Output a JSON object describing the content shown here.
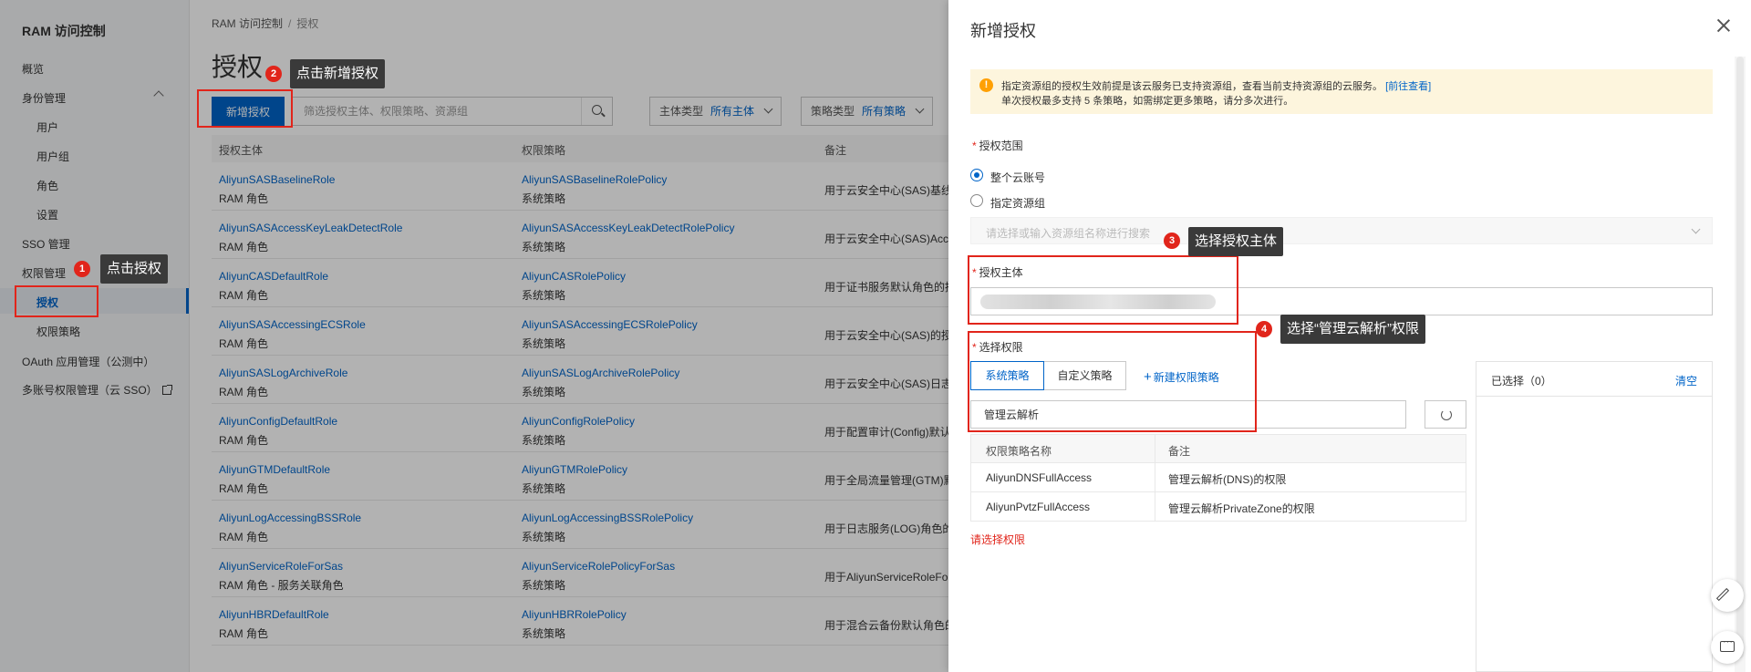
{
  "sidebar": {
    "title": "RAM 访问控制",
    "items": [
      {
        "label": "概览"
      },
      {
        "label": "身份管理"
      },
      {
        "label": "用户"
      },
      {
        "label": "用户组"
      },
      {
        "label": "角色"
      },
      {
        "label": "设置"
      },
      {
        "label": "SSO 管理"
      },
      {
        "label": "权限管理"
      },
      {
        "label": "授权"
      },
      {
        "label": "权限策略"
      },
      {
        "label": "OAuth 应用管理（公测中）"
      },
      {
        "label": "多账号权限管理（云 SSO）"
      }
    ]
  },
  "breadcrumb": {
    "root": "RAM 访问控制",
    "sep": "/",
    "current": "授权"
  },
  "page": {
    "title": "授权",
    "add_button": "新增授权",
    "search_placeholder": "筛选授权主体、权限策略、资源组",
    "filter1_label": "主体类型",
    "filter1_value": "所有主体",
    "filter2_label": "策略类型",
    "filter2_value": "所有策略"
  },
  "table": {
    "headers": [
      "授权主体",
      "权限策略",
      "备注"
    ],
    "rows": [
      {
        "principal": "AliyunSASBaselineRole",
        "ptype": "RAM 角色",
        "policy": "AliyunSASBaselineRolePolicy",
        "pol_type": "系统策略",
        "note": "用于云安全中心(SAS)基线"
      },
      {
        "principal": "AliyunSASAccessKeyLeakDetectRole",
        "ptype": "RAM 角色",
        "policy": "AliyunSASAccessKeyLeakDetectRolePolicy",
        "pol_type": "系统策略",
        "note": "用于云安全中心(SAS)Acce"
      },
      {
        "principal": "AliyunCASDefaultRole",
        "ptype": "RAM 角色",
        "policy": "AliyunCASRolePolicy",
        "pol_type": "系统策略",
        "note": "用于证书服务默认角色的授"
      },
      {
        "principal": "AliyunSASAccessingECSRole",
        "ptype": "RAM 角色",
        "policy": "AliyunSASAccessingECSRolePolicy",
        "pol_type": "系统策略",
        "note": "用于云安全中心(SAS)的授"
      },
      {
        "principal": "AliyunSASLogArchiveRole",
        "ptype": "RAM 角色",
        "policy": "AliyunSASLogArchiveRolePolicy",
        "pol_type": "系统策略",
        "note": "用于云安全中心(SAS)日志"
      },
      {
        "principal": "AliyunConfigDefaultRole",
        "ptype": "RAM 角色",
        "policy": "AliyunConfigRolePolicy",
        "pol_type": "系统策略",
        "note": "用于配置审计(Config)默认"
      },
      {
        "principal": "AliyunGTMDefaultRole",
        "ptype": "RAM 角色",
        "policy": "AliyunGTMRolePolicy",
        "pol_type": "系统策略",
        "note": "用于全局流量管理(GTM)默"
      },
      {
        "principal": "AliyunLogAccessingBSSRole",
        "ptype": "RAM 角色",
        "policy": "AliyunLogAccessingBSSRolePolicy",
        "pol_type": "系统策略",
        "note": "用于日志服务(LOG)角色的"
      },
      {
        "principal": "AliyunServiceRoleForSas",
        "ptype": "RAM 角色 - 服务关联角色",
        "policy": "AliyunServiceRolePolicyForSas",
        "pol_type": "系统策略",
        "note": "用于AliyunServiceRoleFor"
      },
      {
        "principal": "AliyunHBRDefaultRole",
        "ptype": "RAM 角色",
        "policy": "AliyunHBRRolePolicy",
        "pol_type": "系统策略",
        "note": "用于混合云备份默认角色的"
      }
    ]
  },
  "drawer": {
    "title": "新增授权",
    "notice_line1": "指定资源组的授权生效前提是该云服务已支持资源组，查看当前支持资源组的云服务。",
    "notice_link": "[前往查看]",
    "notice_line2": "单次授权最多支持 5 条策略，如需绑定更多策略，请分多次进行。",
    "scope_label": "授权范围",
    "scope_opt1": "整个云账号",
    "scope_opt2": "指定资源组",
    "rg_placeholder": "请选择或输入资源组名称进行搜索",
    "principal_label": "授权主体",
    "perm_label": "选择权限",
    "tab_system": "系统策略",
    "tab_custom": "自定义策略",
    "new_policy": "新建权限策略",
    "keyword": "管理云解析",
    "col_name": "权限策略名称",
    "col_note": "备注",
    "policies": [
      {
        "name": "AliyunDNSFullAccess",
        "note": "管理云解析(DNS)的权限"
      },
      {
        "name": "AliyunPvtzFullAccess",
        "note": "管理云解析PrivateZone的权限"
      }
    ],
    "error": "请选择权限",
    "selected_title": "已选择（0）",
    "clear": "清空"
  },
  "annotations": {
    "s1": "1",
    "t1": "点击授权",
    "s2": "2",
    "t2": "点击新增授权",
    "s3": "3",
    "t3": "选择授权主体",
    "s4": "4",
    "t4": "选择“管理云解析”权限"
  }
}
